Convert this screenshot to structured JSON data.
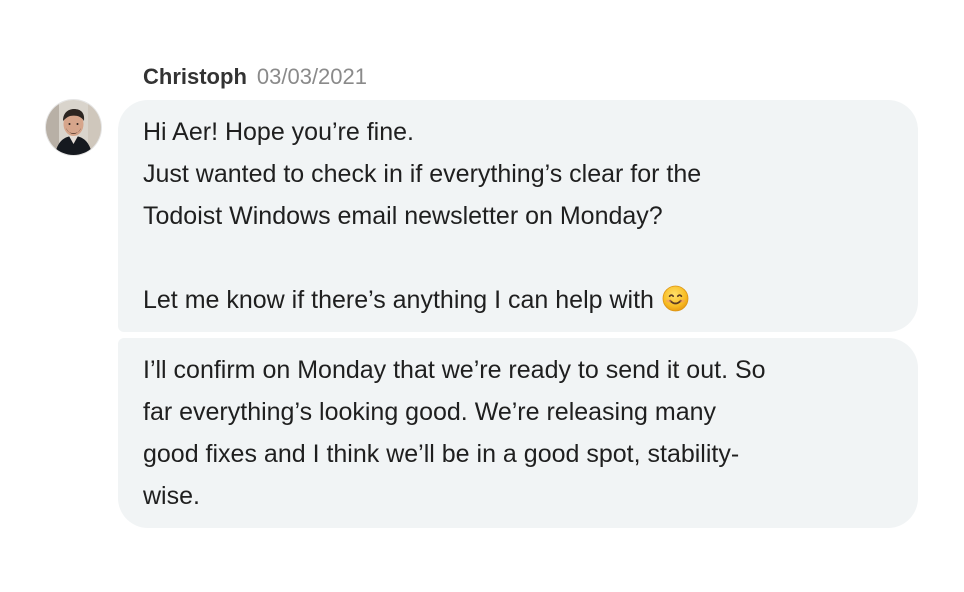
{
  "message_group": {
    "author": "Christoph",
    "date": "03/03/2021",
    "avatar_icon": "user-photo-icon"
  },
  "messages": [
    {
      "lines": [
        "Hi Aer! Hope you’re fine.",
        "Just wanted to check in if everything’s clear for the",
        "Todoist Windows email newsletter on Monday?",
        "",
        "Let me know if there’s anything I can help with"
      ],
      "trailing_icon": "smiling-face-emoji-icon"
    },
    {
      "lines": [
        "I’ll confirm on Monday that we’re ready to send it out. So",
        "far everything’s looking good. We’re releasing many",
        "good fixes and I think we’ll be in a good spot, stability-",
        "wise."
      ]
    }
  ],
  "colors": {
    "bubble_background": "#f1f4f5",
    "author_text": "#333333",
    "timestamp_text": "#8a8a8a",
    "message_text": "#1f1f1f"
  }
}
